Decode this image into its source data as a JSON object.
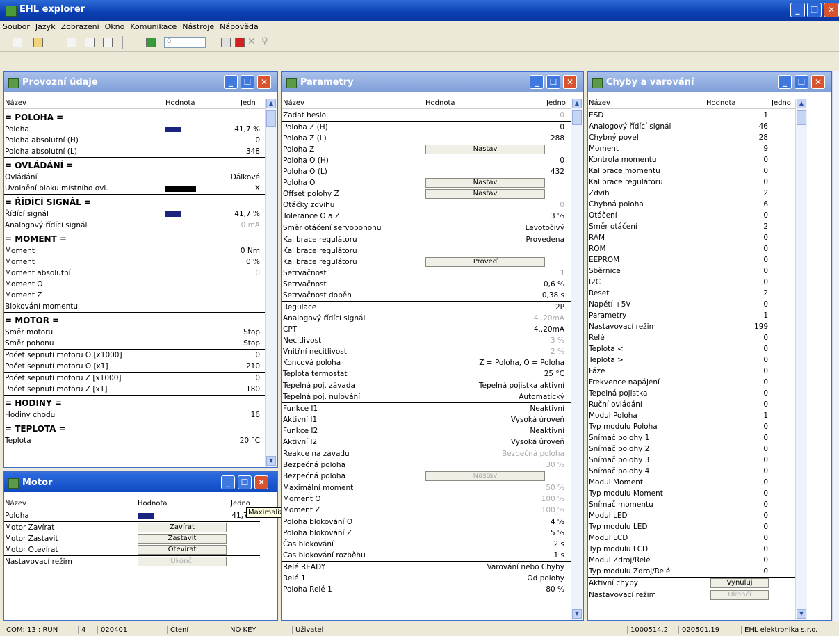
{
  "app": {
    "title": "EHL explorer"
  },
  "menu": [
    "Soubor",
    "Jazyk",
    "Zobrazení",
    "Okno",
    "Komunikace",
    "Nástroje",
    "Nápověda"
  ],
  "toolbar": {
    "spin_value": "0"
  },
  "provoz": {
    "title": "Provozní údaje",
    "cols": {
      "name": "Název",
      "value": "Hodnota",
      "unit": "Jedn"
    },
    "rows": [
      {
        "t": "sec",
        "n": "= POLOHA ="
      },
      {
        "n": "Poloha",
        "v": "41,7 %",
        "bar": "blue"
      },
      {
        "n": "Poloha absolutní (H)",
        "v": "0"
      },
      {
        "n": "Poloha absolutní (L)",
        "v": "348",
        "ul": true
      },
      {
        "t": "sec",
        "n": "= OVLÁDÁNÍ ="
      },
      {
        "n": "Ovládání",
        "v": "Dálkové"
      },
      {
        "n": "Uvolnění bloku místního ovl.",
        "v": "X",
        "bar": "black",
        "ul": true
      },
      {
        "t": "sec",
        "n": "= ŘÍDÍCÍ SIGNÁL ="
      },
      {
        "n": "Řídící signál",
        "v": "41,7 %",
        "bar": "blue"
      },
      {
        "n": "Analogový řídící signál",
        "v": "0 mA",
        "g": true,
        "ul": true
      },
      {
        "t": "sec",
        "n": "= MOMENT ="
      },
      {
        "n": "Moment",
        "v": "0 Nm"
      },
      {
        "n": "Moment",
        "v": "0 %"
      },
      {
        "n": "Moment absolutní",
        "v": "0",
        "g": true
      },
      {
        "n": "Moment O",
        "v": ""
      },
      {
        "n": "Moment Z",
        "v": ""
      },
      {
        "n": "Blokování momentu",
        "v": "",
        "ul": true
      },
      {
        "t": "sec",
        "n": "= MOTOR ="
      },
      {
        "n": "Směr motoru",
        "v": "Stop"
      },
      {
        "n": "Směr pohonu",
        "v": "Stop",
        "ul": true
      },
      {
        "n": "Počet sepnutí motoru O [x1000]",
        "v": "0"
      },
      {
        "n": "Počet sepnutí motoru O [x1]",
        "v": "210",
        "ul": true
      },
      {
        "n": "Počet sepnutí motoru Z [x1000]",
        "v": "0"
      },
      {
        "n": "Počet sepnutí motoru Z [x1]",
        "v": "180",
        "ul": true
      },
      {
        "t": "sec",
        "n": "= HODINY ="
      },
      {
        "n": "Hodiny chodu",
        "v": "16",
        "ul": true
      },
      {
        "t": "sec",
        "n": "= TEPLOTA ="
      },
      {
        "n": "Teplota",
        "v": "20 °C"
      }
    ]
  },
  "motor": {
    "title": "Motor",
    "cols": {
      "name": "Název",
      "value": "Hodnota",
      "unit": "Jedno"
    },
    "rows": [
      {
        "n": "Poloha",
        "v": "41,7 %",
        "bar": "blue",
        "ul": true
      },
      {
        "n": "Motor Zavírat",
        "btn": "Zavírat"
      },
      {
        "n": "Motor Zastavit",
        "btn": "Zastavit"
      },
      {
        "n": "Motor Otevírat",
        "btn": "Otevírat",
        "ul": true
      },
      {
        "n": "Nastavovací režim",
        "btn": "Ukonči",
        "dis": true
      }
    ],
    "tooltip": "Maximalizovat"
  },
  "param": {
    "title": "Parametry",
    "cols": {
      "name": "Název",
      "value": "Hodnota",
      "unit": "Jedno"
    },
    "rows": [
      {
        "n": "Zadat heslo",
        "v": "0",
        "g": true,
        "ul": true
      },
      {
        "n": "Poloha Z (H)",
        "v": "0"
      },
      {
        "n": "Poloha Z (L)",
        "v": "288"
      },
      {
        "n": "Poloha Z",
        "btn": "Nastav"
      },
      {
        "n": "Poloha O (H)",
        "v": "0"
      },
      {
        "n": "Poloha O (L)",
        "v": "432"
      },
      {
        "n": "Poloha O",
        "btn": "Nastav"
      },
      {
        "n": "Offset polohy Z",
        "btn": "Nastav"
      },
      {
        "n": "Otáčky zdvihu",
        "v": "0",
        "g": true
      },
      {
        "n": "Tolerance O a Z",
        "v": "3 %",
        "ul": true
      },
      {
        "n": "Směr otáčení servopohonu",
        "v": "Levotočivý",
        "ul": true
      },
      {
        "n": "Kalibrace regulátoru",
        "v": "Provedena"
      },
      {
        "n": "Kalibrace regulátoru",
        "v": ""
      },
      {
        "n": "Kalibrace regulátoru",
        "btn": "Proveď"
      },
      {
        "n": "Setrvačnost",
        "v": "1"
      },
      {
        "n": "Setrvačnost",
        "v": "0,6 %"
      },
      {
        "n": "Setrvačnost doběh",
        "v": "0,38 s",
        "ul": true
      },
      {
        "n": "Regulace",
        "v": "2P"
      },
      {
        "n": "Analogový řídící signál",
        "v": "4..20mA",
        "g": true
      },
      {
        "n": "CPT",
        "v": "4..20mA"
      },
      {
        "n": "Necitlivost",
        "v": "3 %",
        "g": true
      },
      {
        "n": "Vnitřní necitlivost",
        "v": "2 %",
        "g": true
      },
      {
        "n": "Koncová poloha",
        "v": "Z = Poloha, O = Poloha"
      },
      {
        "n": "Teplota termostat",
        "v": "25 °C",
        "ul": true
      },
      {
        "n": "Tepelná poj. závada",
        "v": "Tepelná pojistka aktivní"
      },
      {
        "n": "Tepelná poj. nulování",
        "v": "Automatický",
        "ul": true
      },
      {
        "n": "Funkce I1",
        "v": "Neaktivní"
      },
      {
        "n": "Aktivní I1",
        "v": "Vysoká úroveň"
      },
      {
        "n": "Funkce I2",
        "v": "Neaktivní"
      },
      {
        "n": "Aktivní I2",
        "v": "Vysoká úroveň",
        "ul": true
      },
      {
        "n": "Reakce na závadu",
        "v": "Bezpečná poloha",
        "g": true
      },
      {
        "n": "Bezpečná poloha",
        "v": "30 %",
        "g": true
      },
      {
        "n": "Bezpečná poloha",
        "btn": "Nastav",
        "dis": true,
        "ul": true
      },
      {
        "n": "Maximální moment",
        "v": "50 %",
        "g": true
      },
      {
        "n": "Moment O",
        "v": "100 %",
        "g": true
      },
      {
        "n": "Moment Z",
        "v": "100 %",
        "g": true,
        "ul": true
      },
      {
        "n": "Poloha blokování O",
        "v": "4 %"
      },
      {
        "n": "Poloha blokování Z",
        "v": "5 %"
      },
      {
        "n": "Čas blokování",
        "v": "2 s"
      },
      {
        "n": "Čas blokování rozběhu",
        "v": "1 s",
        "ul": true
      },
      {
        "n": "Relé READY",
        "v": "Varování nebo Chyby"
      },
      {
        "n": "Relé 1",
        "v": "Od polohy"
      },
      {
        "n": "Poloha Relé 1",
        "v": "80 %"
      }
    ]
  },
  "chyby": {
    "title": "Chyby a varování",
    "cols": {
      "name": "Název",
      "value": "Hodnota",
      "unit": "Jedno"
    },
    "rows": [
      {
        "n": "ESD",
        "v": "1"
      },
      {
        "n": "Analogový řídící signál",
        "v": "46"
      },
      {
        "n": "Chybný povel",
        "v": "28"
      },
      {
        "n": "Moment",
        "v": "9"
      },
      {
        "n": "Kontrola momentu",
        "v": "0"
      },
      {
        "n": "Kalibrace momentu",
        "v": "0"
      },
      {
        "n": "Kalibrace regulátoru",
        "v": "0"
      },
      {
        "n": "Zdvih",
        "v": "2"
      },
      {
        "n": "Chybná poloha",
        "v": "6"
      },
      {
        "n": "Otáčení",
        "v": "0"
      },
      {
        "n": "Směr otáčení",
        "v": "2"
      },
      {
        "n": "RAM",
        "v": "0"
      },
      {
        "n": "ROM",
        "v": "0"
      },
      {
        "n": "EEPROM",
        "v": "0"
      },
      {
        "n": "Sběrnice",
        "v": "0"
      },
      {
        "n": "I2C",
        "v": "0"
      },
      {
        "n": "Reset",
        "v": "2"
      },
      {
        "n": "Napětí +5V",
        "v": "0"
      },
      {
        "n": "Parametry",
        "v": "1"
      },
      {
        "n": "Nastavovací režim",
        "v": "199"
      },
      {
        "n": "Relé",
        "v": "0"
      },
      {
        "n": "Teplota <",
        "v": "0"
      },
      {
        "n": "Teplota >",
        "v": "0"
      },
      {
        "n": "Fáze",
        "v": "0"
      },
      {
        "n": "Frekvence napájení",
        "v": "0"
      },
      {
        "n": "Tepelná pojistka",
        "v": "0"
      },
      {
        "n": "Ruční ovládání",
        "v": "0"
      },
      {
        "n": "Modul Poloha",
        "v": "1"
      },
      {
        "n": "Typ modulu Poloha",
        "v": "0"
      },
      {
        "n": "Snímač polohy 1",
        "v": "0"
      },
      {
        "n": "Snímač polohy 2",
        "v": "0"
      },
      {
        "n": "Snímač polohy 3",
        "v": "0"
      },
      {
        "n": "Snímač polohy 4",
        "v": "0"
      },
      {
        "n": "Modul Moment",
        "v": "0"
      },
      {
        "n": "Typ modulu Moment",
        "v": "0"
      },
      {
        "n": "Snímač momentu",
        "v": "0"
      },
      {
        "n": "Modul LED",
        "v": "0"
      },
      {
        "n": "Typ modulu LED",
        "v": "0"
      },
      {
        "n": "Modul LCD",
        "v": "0"
      },
      {
        "n": "Typ modulu LCD",
        "v": "0"
      },
      {
        "n": "Modul Zdroj/Relé",
        "v": "0"
      },
      {
        "n": "Typ modulu Zdroj/Relé",
        "v": "0",
        "ul": true
      },
      {
        "n": "Aktivní chyby",
        "btn": "Vynuluj",
        "ul": true
      },
      {
        "n": "Nastavovací režim",
        "btn": "Ukonči",
        "dis": true
      }
    ]
  },
  "status": [
    "COM: 13 : RUN",
    "4",
    "020401",
    "Čtení",
    "NO KEY",
    "Uživatel",
    "1000514.2",
    "020501.19",
    "EHL elektronika s.r.o."
  ]
}
